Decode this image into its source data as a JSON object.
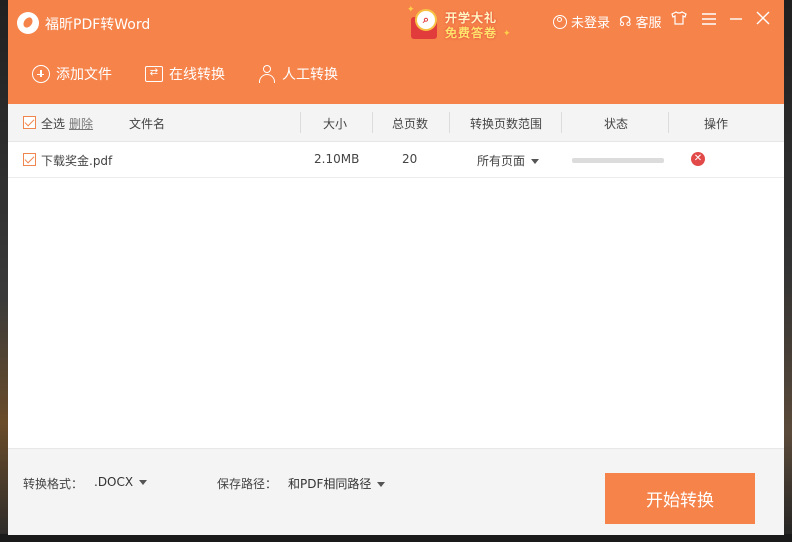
{
  "app": {
    "title": "福昕PDF转Word",
    "accent_color": "#f5834a",
    "promo": {
      "line1": "开学大礼",
      "line2": "免费答卷",
      "badge_icon": "search-icon"
    },
    "header_actions": {
      "login_label": "未登录",
      "service_label": "客服"
    },
    "window_controls": {
      "skin_icon": "tshirt-icon",
      "menu_icon": "menu-icon",
      "minimize_icon": "minimize-icon",
      "close_icon": "close-icon"
    }
  },
  "toolbar": {
    "add_file": "添加文件",
    "online_convert": "在线转换",
    "manual_convert": "人工转换"
  },
  "table": {
    "headers": {
      "select_all": "全选",
      "delete": "删除",
      "file_name": "文件名",
      "size": "大小",
      "total_pages": "总页数",
      "page_range": "转换页数范围",
      "status": "状态",
      "action": "操作"
    },
    "rows": [
      {
        "checked": true,
        "file_name": "下载奖金.pdf",
        "size": "2.10MB",
        "pages": "20",
        "page_range": "所有页面",
        "progress": 0
      }
    ]
  },
  "footer": {
    "format_label": "转换格式：",
    "format_value": ".DOCX",
    "path_label": "保存路径：",
    "path_value": "和PDF相同路径",
    "start_button": "开始转换"
  }
}
